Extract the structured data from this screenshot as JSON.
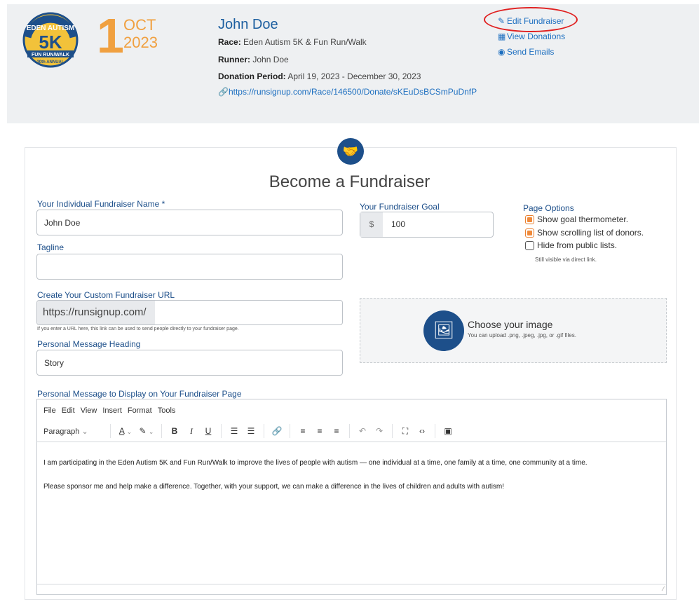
{
  "header": {
    "logo_text": "EDEN AUTISM 5K FUN RUN/WALK 30th ANNUAL",
    "date_day": "1",
    "date_month": "OCT",
    "date_year": "2023",
    "runner_name": "John Doe",
    "race_label": "Race:",
    "race_value": "Eden Autism 5K & Fun Run/Walk",
    "runner_label": "Runner:",
    "runner_value": "John Doe",
    "period_label": "Donation Period:",
    "period_value": "April 19, 2023 - December 30, 2023",
    "donate_url": "https://runsignup.com/Race/146500/Donate/sKEuDsBCSmPuDnfP",
    "actions": {
      "edit": "Edit Fundraiser",
      "view": "View Donations",
      "send": "Send Emails"
    },
    "accent_color": "#f0a040",
    "link_color": "#1d6fc0",
    "annotation_color": "#e02020"
  },
  "form": {
    "title": "Become a Fundraiser",
    "name_label": "Your Individual Fundraiser Name *",
    "name_value": "John Doe",
    "goal_label": "Your Fundraiser Goal",
    "goal_prefix": "$",
    "goal_value": "100",
    "tagline_label": "Tagline",
    "tagline_value": "",
    "url_label": "Create Your Custom Fundraiser URL",
    "url_prefix": "https://runsignup.com/",
    "url_hint": "If you enter a URL here, this link can be used to send people directly to your fundraiser page.",
    "heading_label": "Personal Message Heading",
    "heading_value": "Story",
    "message_label": "Personal Message to Display on Your Fundraiser Page",
    "options_title": "Page Options",
    "options": [
      {
        "label": "Show goal thermometer.",
        "checked": true
      },
      {
        "label": "Show scrolling list of donors.",
        "checked": true
      },
      {
        "label": "Hide from public lists.",
        "checked": false
      }
    ],
    "options_hint": "Still visible via direct link.",
    "upload_title": "Choose your image",
    "upload_sub": "You can upload .png, .jpeg, .jpg, or .gif files."
  },
  "editor": {
    "menu": [
      "File",
      "Edit",
      "View",
      "Insert",
      "Format",
      "Tools"
    ],
    "block_format": "Paragraph",
    "paragraph1": "I am participating in the Eden Autism 5K and Fun Run/Walk to improve the lives of people with autism — one individual at a time, one family at a time, one community at a time.",
    "paragraph2": "Please sponsor me and help make a difference. Together, with your support, we can make a difference in the lives of children and adults with autism!"
  }
}
